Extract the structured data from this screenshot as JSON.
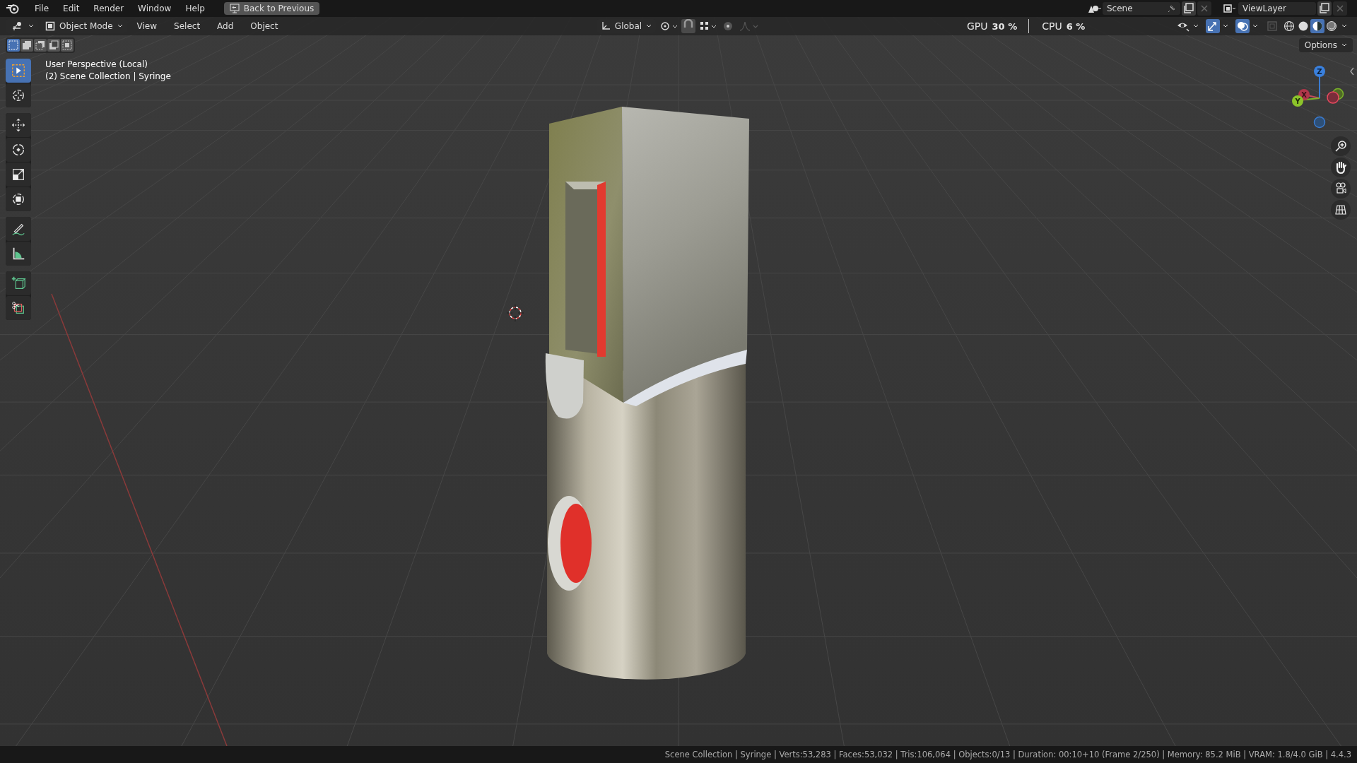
{
  "menu_bar": {
    "items": [
      "File",
      "Edit",
      "Render",
      "Window",
      "Help"
    ],
    "back_button": "Back to Previous"
  },
  "scene_field": "Scene",
  "view_layer_field": "ViewLayer",
  "performance": {
    "gpu_label": "GPU",
    "gpu_value": "30 %",
    "cpu_label": "CPU",
    "cpu_value": "6 %"
  },
  "header": {
    "mode": "Object Mode",
    "menus": [
      "View",
      "Select",
      "Add",
      "Object"
    ],
    "orientation": "Global"
  },
  "viewport_toggles": [
    {
      "kind": "visibility",
      "on": false
    },
    {
      "kind": "gizmos",
      "on": true
    },
    {
      "kind": "overlays",
      "on": true
    },
    {
      "kind": "xray",
      "on": false
    }
  ],
  "shading_modes": [
    {
      "kind": "wireframe",
      "selected": false
    },
    {
      "kind": "solid",
      "selected": false
    },
    {
      "kind": "material",
      "selected": true
    },
    {
      "kind": "rendered",
      "selected": false
    }
  ],
  "selection_modes": [
    {
      "kind": "new",
      "selected": true
    },
    {
      "kind": "extend",
      "selected": false
    },
    {
      "kind": "subtract",
      "selected": false
    },
    {
      "kind": "invert",
      "selected": false
    },
    {
      "kind": "intersect",
      "selected": false
    }
  ],
  "options_button": "Options",
  "tool_groups": [
    [
      {
        "kind": "select",
        "selected": true
      },
      {
        "kind": "cursor",
        "selected": false
      }
    ],
    [
      {
        "kind": "move",
        "selected": false
      },
      {
        "kind": "rotate",
        "selected": false
      },
      {
        "kind": "scale",
        "selected": false
      },
      {
        "kind": "transform",
        "selected": false
      }
    ],
    [
      {
        "kind": "annotate",
        "selected": false
      },
      {
        "kind": "measure",
        "selected": false
      }
    ],
    [
      {
        "kind": "add-cube",
        "selected": false
      },
      {
        "kind": "cut",
        "selected": false
      }
    ]
  ],
  "viewport_info": [
    "User Perspective (Local)",
    "(2) Scene Collection | Syringe"
  ],
  "gizmo_axes": [
    "Z",
    "Y",
    "X"
  ],
  "status_bar": "Scene Collection | Syringe | Verts:53,283 | Faces:53,032 | Tris:106,064 | Objects:0/13 | Duration: 00:10+10 (Frame 2/250) | Memory: 85.2 MiB | VRAM: 1.8/4.0 GiB | 4.4.3"
}
